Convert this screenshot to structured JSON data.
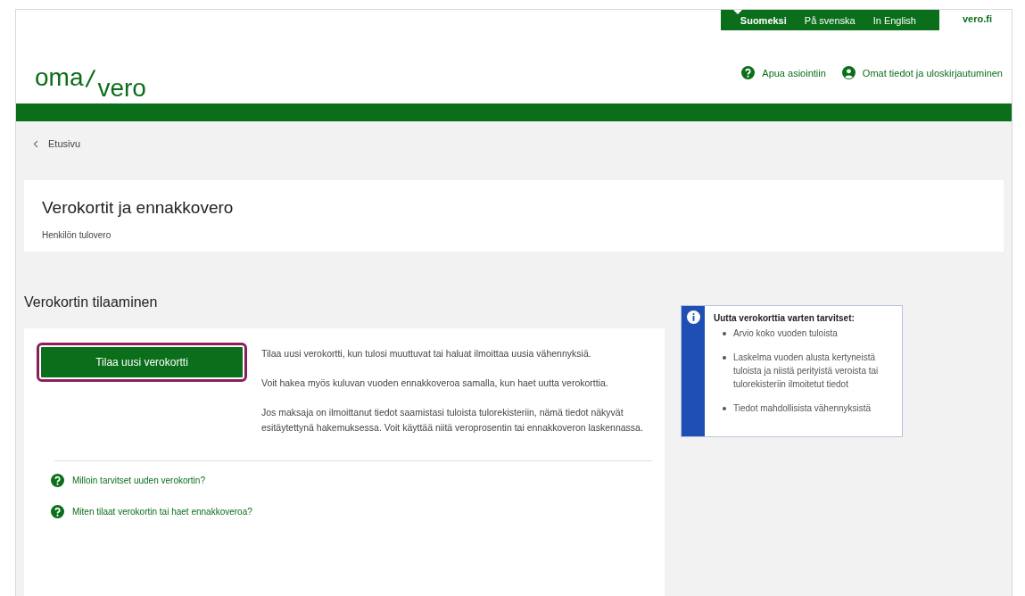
{
  "logo": {
    "left": "oma",
    "right": "vero"
  },
  "languages": [
    {
      "label": "Suomeksi",
      "selected": true
    },
    {
      "label": "På svenska",
      "selected": false
    },
    {
      "label": "In English",
      "selected": false
    }
  ],
  "site_link": "vero.fi",
  "header_links": [
    {
      "label": "Apua asiointiin",
      "kind": "help"
    },
    {
      "label": "Omat tiedot ja uloskirjautuminen",
      "kind": "user"
    }
  ],
  "breadcrumb": {
    "label": "Etusivu"
  },
  "page_card": {
    "title": "Verokortit ja ennakkovero",
    "subtitle": "Henkilön tulovero"
  },
  "section_title": "Verokortin tilaaminen",
  "order_card": {
    "button": {
      "label": "Tilaa uusi verokortti",
      "focused": true
    },
    "paragraphs": [
      "Tilaa uusi verokortti, kun tulosi muuttuvat tai haluat ilmoittaa uusia vähennyksiä.",
      "Voit hakea myös kuluvan vuoden ennakkoveroa samalla, kun haet uutta verokorttia.",
      "Jos maksaja on ilmoittanut tiedot saamistasi tuloista tulorekisteriin, nämä tiedot näkyvät esitäytettynä hakemuksessa. Voit käyttää niitä veroprosentin tai ennakkoveron laskennassa."
    ],
    "help_links": [
      "Milloin tarvitset uuden verokortin?",
      "Miten tilaat verokortin tai haet ennakkoveroa?"
    ]
  },
  "info_box": {
    "title": "Uutta verokorttia varten tarvitset:",
    "items": [
      "Arvio koko vuoden tuloista",
      "Laskelma vuoden alusta kertyneistä tuloista ja niistä perityistä veroista tai tulorekisteriin ilmoitetut tiedot",
      "Tiedot mahdollisista vähennyksistä"
    ]
  }
}
